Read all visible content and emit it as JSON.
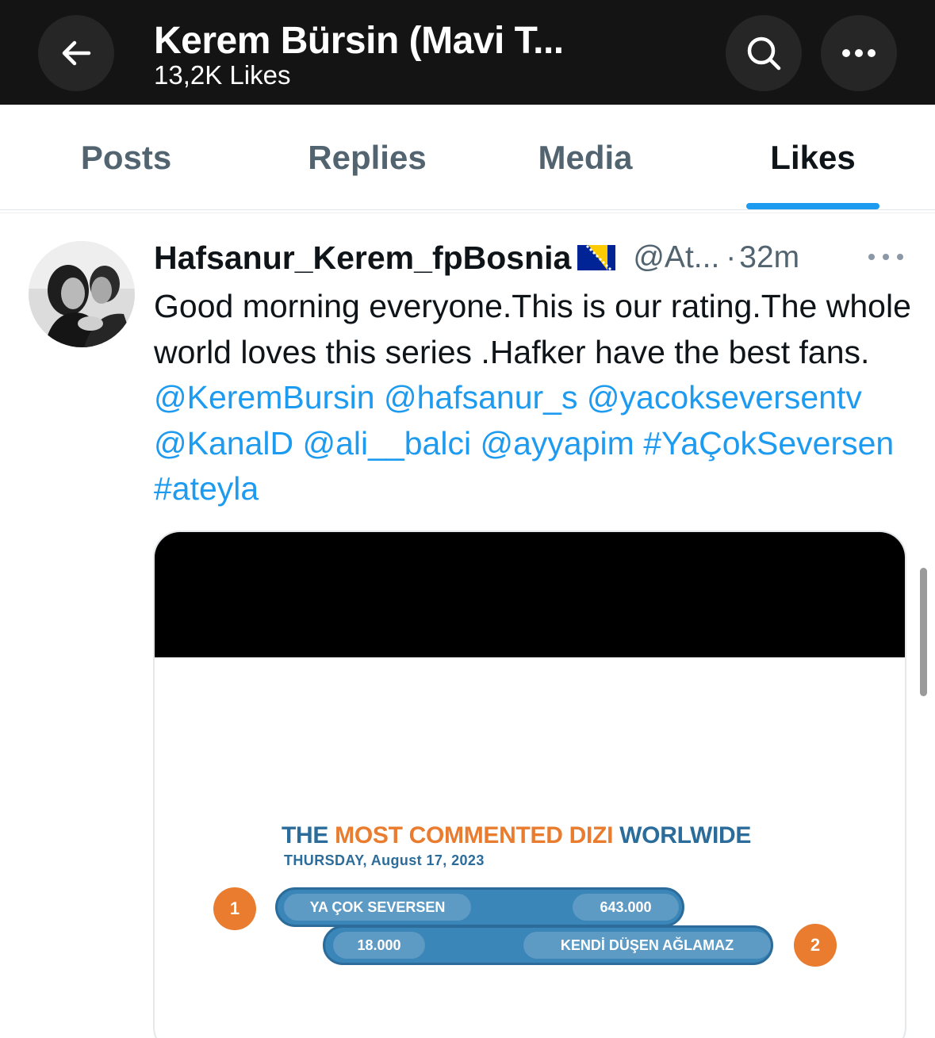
{
  "header": {
    "title": "Kerem Bürsin (Mavi T...",
    "subtitle": "13,2K Likes",
    "back_icon": "arrow-left-icon",
    "search_icon": "search-icon",
    "more_icon": "more-horizontal-icon"
  },
  "tabs": [
    {
      "label": "Posts",
      "active": false
    },
    {
      "label": "Replies",
      "active": false
    },
    {
      "label": "Media",
      "active": false
    },
    {
      "label": "Likes",
      "active": true
    }
  ],
  "colors": {
    "accent": "#1d9bf0",
    "infographic_blue": "#2b6c9a",
    "infographic_orange": "#e97c2e"
  },
  "tweet": {
    "display_name": "Hafsanur_Kerem_fpBosnia",
    "flag": "bosnia-flag",
    "handle": "@At...",
    "separator": "·",
    "time": "32m",
    "text": {
      "plain": "Good morning everyone.This is our rating.The whole world loves this series .Hafker have the best fans.",
      "links": [
        "@KeremBursin",
        "@hafsanur_s",
        "@yacokseversentv",
        "@KanalD",
        "@ali__balci",
        "@ayyapim",
        "#YaÇokSeversen",
        "#ateyla"
      ]
    },
    "media": {
      "title_part1": "THE",
      "title_part2": "MOST COMMENTED DIZI",
      "title_part3": "WORLWIDE",
      "date": "THURSDAY, August 17, 2023",
      "ranking": [
        {
          "rank": "1",
          "name": "YA ÇOK SEVERSEN",
          "value": "643.000"
        },
        {
          "rank": "2",
          "name": "KENDİ DÜŞEN AĞLAMAZ",
          "value": "18.000"
        }
      ]
    }
  }
}
